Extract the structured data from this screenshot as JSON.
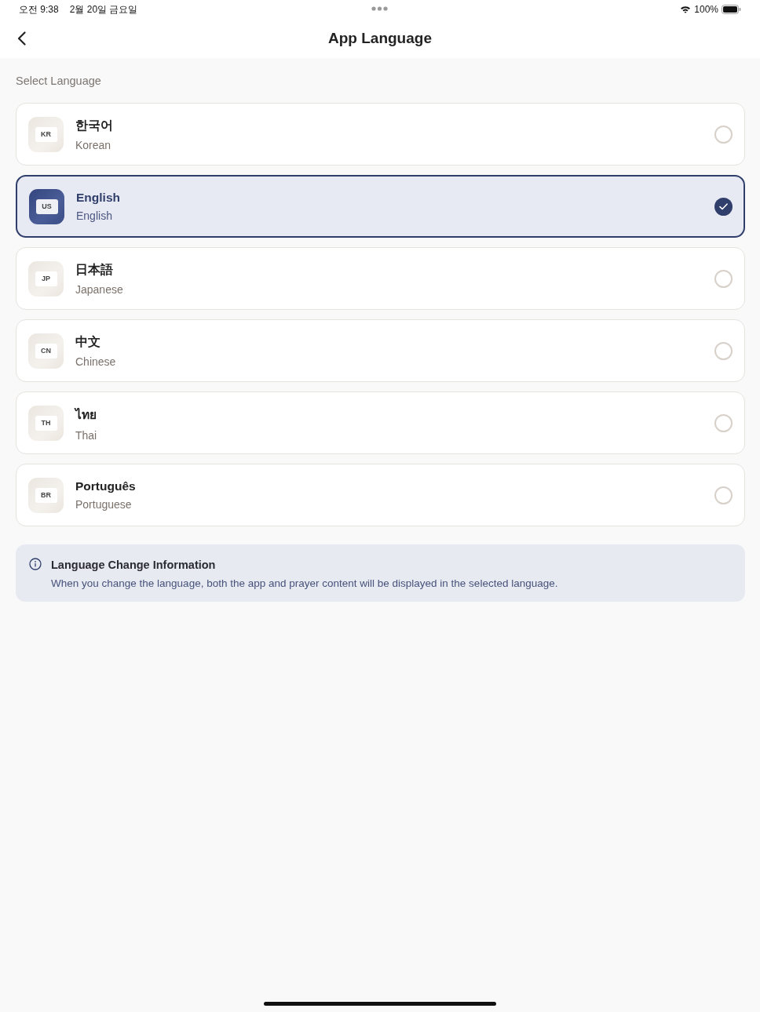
{
  "status_bar": {
    "time": "오전 9:38",
    "date": "2월 20일 금요일",
    "battery": "100%"
  },
  "header": {
    "title": "App Language"
  },
  "section_label": "Select Language",
  "languages": [
    {
      "code": "KR",
      "name": "한국어",
      "english_name": "Korean",
      "selected": false
    },
    {
      "code": "US",
      "name": "English",
      "english_name": "English",
      "selected": true
    },
    {
      "code": "JP",
      "name": "日本語",
      "english_name": "Japanese",
      "selected": false
    },
    {
      "code": "CN",
      "name": "中文",
      "english_name": "Chinese",
      "selected": false
    },
    {
      "code": "TH",
      "name": "ไทย",
      "english_name": "Thai",
      "selected": false
    },
    {
      "code": "BR",
      "name": "Português",
      "english_name": "Portuguese",
      "selected": false
    }
  ],
  "info": {
    "title": "Language Change Information",
    "body": "When you change the language, both the app and prayer content will be displayed in the selected language."
  }
}
